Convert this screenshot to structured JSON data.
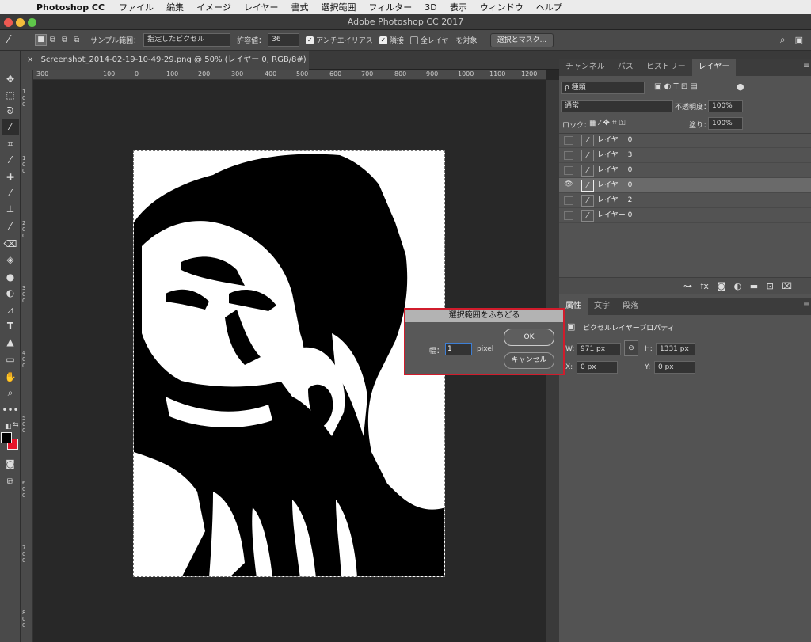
{
  "menubar": {
    "app": "Photoshop CC",
    "items": [
      "ファイル",
      "編集",
      "イメージ",
      "レイヤー",
      "書式",
      "選択範囲",
      "フィルター",
      "3D",
      "表示",
      "ウィンドウ",
      "ヘルプ"
    ]
  },
  "window": {
    "title": "Adobe Photoshop CC 2017"
  },
  "options": {
    "sample_label": "サンプル範囲：",
    "sample_value": "指定したピクセル",
    "tolerance_label": "許容値：",
    "tolerance_value": "36",
    "antialias_label": "アンチエイリアス",
    "contiguous_label": "隣接",
    "all_layers_label": "全レイヤーを対象",
    "select_mask_button": "選択とマスク..."
  },
  "document": {
    "tab_title": "Screenshot_2014-02-19-10-49-29.png @ 50% (レイヤー 0, RGB/8#) *"
  },
  "ruler": {
    "h_labels": [
      "300",
      "100",
      "0",
      "100",
      "200",
      "300",
      "400",
      "500",
      "600",
      "700",
      "800",
      "900",
      "1000",
      "1100",
      "1200"
    ],
    "v_labels": [
      "1",
      "0",
      "0",
      "1",
      "0",
      "0",
      "2",
      "0",
      "0",
      "3",
      "0",
      "0",
      "4",
      "0",
      "0",
      "5",
      "0",
      "0",
      "6",
      "0",
      "0",
      "7",
      "0",
      "0",
      "8",
      "0",
      "0",
      "9",
      "0",
      "0"
    ]
  },
  "layers_panel": {
    "tabs": [
      "チャンネル",
      "パス",
      "ヒストリー",
      "レイヤー"
    ],
    "filter_label": "ρ 種類",
    "blend_mode": "通常",
    "opacity_label": "不透明度：",
    "opacity_value": "100%",
    "lock_label": "ロック：",
    "fill_label": "塗り：",
    "fill_value": "100%",
    "layers": [
      {
        "name": "レイヤー 0",
        "visible": false
      },
      {
        "name": "レイヤー 3",
        "visible": false
      },
      {
        "name": "レイヤー 0",
        "visible": false
      },
      {
        "name": "レイヤー 0",
        "visible": true,
        "selected": true
      },
      {
        "name": "レイヤー 2",
        "visible": false
      },
      {
        "name": "レイヤー 0",
        "visible": false
      }
    ]
  },
  "properties_panel": {
    "tabs": [
      "属性",
      "文字",
      "段落"
    ],
    "header": "ピクセルレイヤープロパティ",
    "w_label": "W:",
    "w_value": "971 px",
    "h_label": "H:",
    "h_value": "1331 px",
    "x_label": "X:",
    "x_value": "0 px",
    "y_label": "Y:",
    "y_value": "0 px"
  },
  "dialog": {
    "title": "選択範囲をふちどる",
    "width_label": "幅：",
    "width_value": "1",
    "unit": "pixel",
    "ok_button": "OK",
    "cancel_button": "キャンセル"
  },
  "colors": {
    "accent": "#d11c2c",
    "panel_bg": "#535353"
  }
}
